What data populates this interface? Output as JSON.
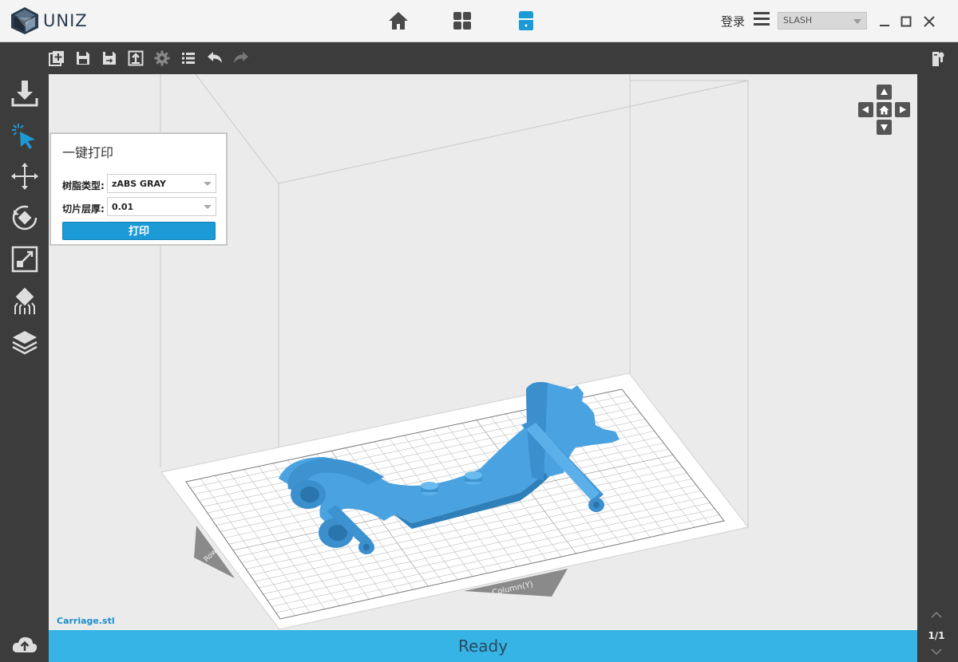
{
  "app": {
    "logo_text": "UNIZ",
    "login_label": "登录",
    "printer": "SLASH"
  },
  "nav": {
    "active": "printer",
    "active_color": "#1c9ad6"
  },
  "panel": {
    "title": "一键打印",
    "resin_label": "树脂类型:",
    "resin_value": "zABS GRAY",
    "layer_label": "切片层厚:",
    "layer_value": "0.01",
    "print_label": "打印"
  },
  "viewport": {
    "file_name": "Carriage.stl",
    "axis_x_label": "Row(X)",
    "axis_y_label": "Column(Y)"
  },
  "status": {
    "text": "Ready"
  },
  "pager": {
    "label": "1/1"
  },
  "colors": {
    "accent": "#1c9ad6",
    "status_bar": "#35b4e5",
    "model": "#4aa3e0",
    "sidebar": "#3c3c3c"
  },
  "icons": {
    "toolbar": [
      "add-file-icon",
      "save-icon",
      "save-as-icon",
      "export-icon",
      "settings-icon",
      "list-icon",
      "undo-icon",
      "redo-icon"
    ],
    "sidebar": [
      "download-icon",
      "select-icon",
      "move-icon",
      "rotate-icon",
      "scale-icon",
      "support-icon",
      "layers-icon"
    ]
  }
}
